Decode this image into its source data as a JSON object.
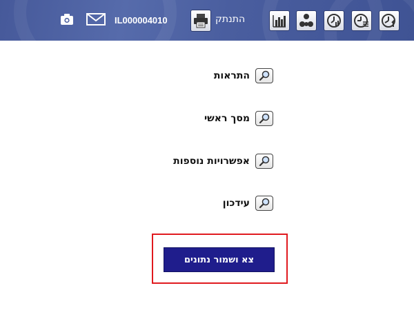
{
  "header": {
    "user_id": "IL000004010",
    "logout_label": "התנתק",
    "icons": [
      "camera-icon",
      "mail-icon",
      "printer-icon",
      "bar-chart-icon",
      "hierarchy-icon",
      "clock-chart-icon",
      "clock-list-icon",
      "clock-one-icon"
    ],
    "background_color": "#4a5e9f"
  },
  "menu": {
    "items": [
      {
        "label": "התראות"
      },
      {
        "label": "מסך ראשי"
      },
      {
        "label": "אפשרויות נוספות"
      },
      {
        "label": "עידכון"
      }
    ]
  },
  "action": {
    "save_label": "צא ושמור נתונים",
    "button_color": "#1f1d8c",
    "highlight_color": "#e0191e"
  }
}
